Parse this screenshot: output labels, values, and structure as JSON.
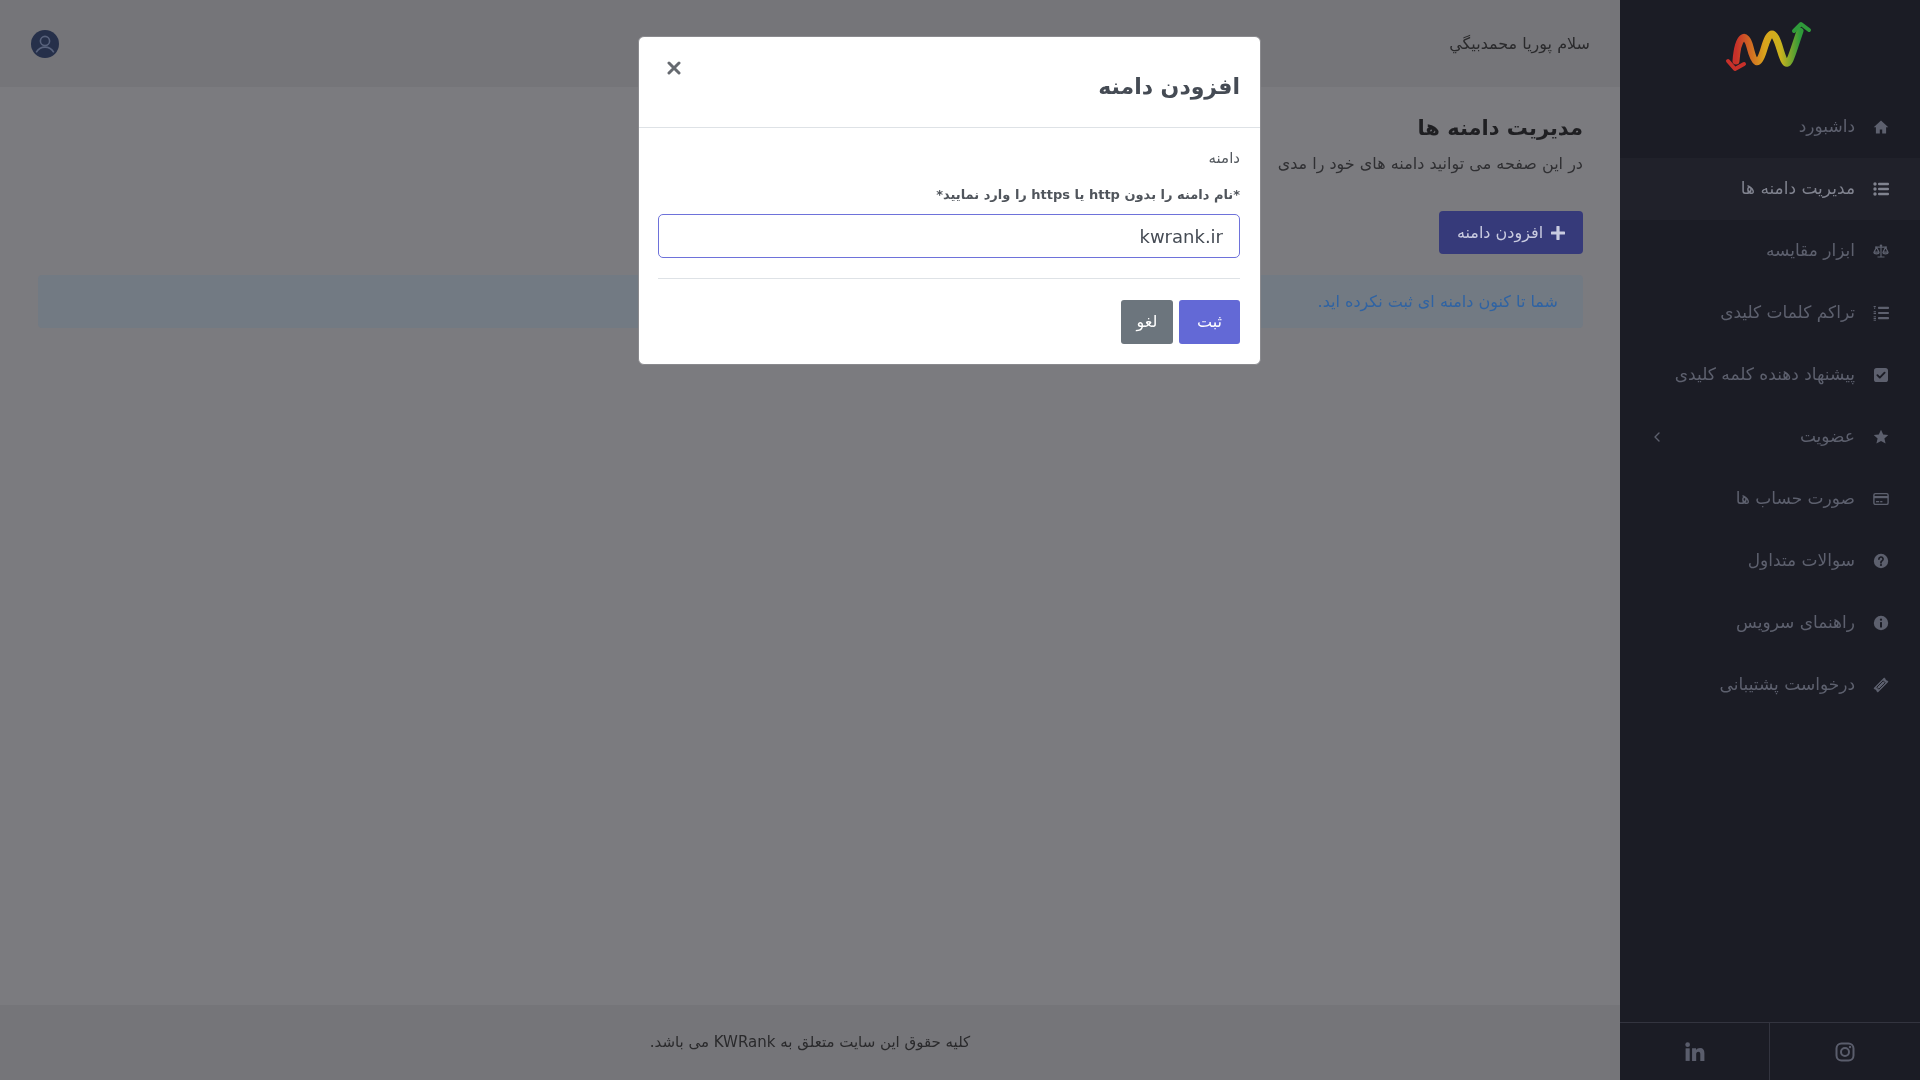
{
  "header": {
    "greeting": "سلام پوریا محمدبیگي"
  },
  "page": {
    "title": "مدیریت دامنه ها",
    "description": "در این صفحه می توانید دامنه های خود را مدی",
    "add_button": {
      "label": "افزودن دامنه"
    },
    "alert": {
      "text": "شما تا کنون دامنه ای ثبت نکرده اید."
    }
  },
  "modal": {
    "title": "افزودن دامنه",
    "field_label": "دامنه",
    "hint": "*نام دامنه را بدون http یا https را وارد نمایید*",
    "input": {
      "value": "kwrank.ir",
      "focused": true
    },
    "buttons": [
      {
        "label": "ثبت",
        "kind": "primary"
      },
      {
        "label": "لغو",
        "kind": "secondary"
      }
    ]
  },
  "sidebar": {
    "items": [
      {
        "label": "داشبورد",
        "kind": "link",
        "selected": false
      },
      {
        "label": "مدیریت دامنه ها",
        "kind": "link",
        "selected": true
      },
      {
        "label": "ابزار مقایسه",
        "kind": "link",
        "selected": false
      },
      {
        "label": "تراکم کلمات کلیدی",
        "kind": "link",
        "selected": false
      },
      {
        "label": "پیشنهاد دهنده کلمه کلیدی",
        "kind": "link",
        "selected": false
      },
      {
        "label": "عضویت",
        "kind": "submenu",
        "expanded": false,
        "selected": false
      },
      {
        "label": "صورت حساب ها",
        "kind": "link",
        "selected": false
      },
      {
        "label": "سوالات متداول",
        "kind": "link",
        "selected": false
      },
      {
        "label": "راهنمای سرویس",
        "kind": "link",
        "selected": false
      },
      {
        "label": "درخواست پشتیبانی",
        "kind": "link",
        "selected": false
      }
    ]
  },
  "footer": {
    "text": "کلیه حقوق این سایت متعلق به KWRank می باشد."
  }
}
